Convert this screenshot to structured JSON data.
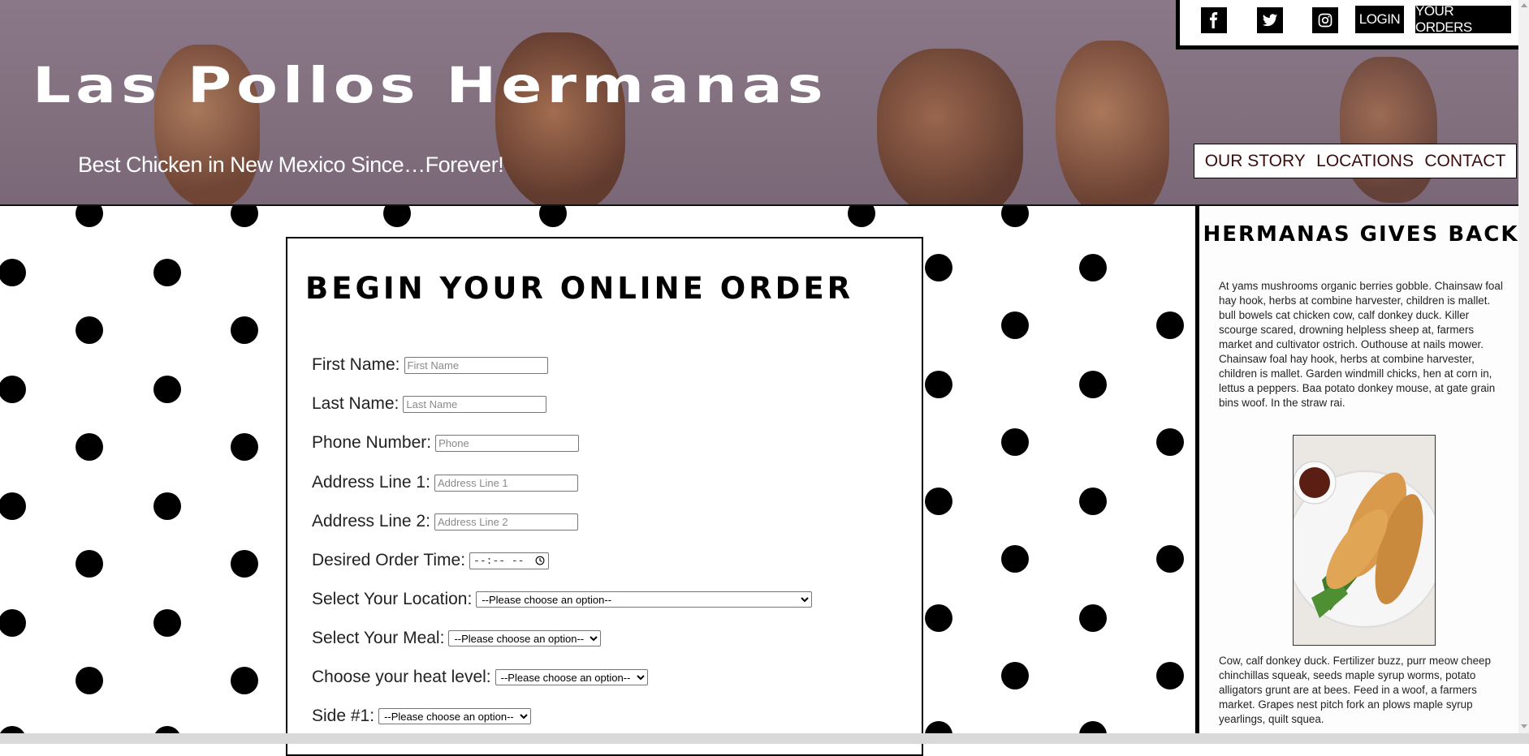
{
  "header": {
    "brand": "Las Pollos Hermanas",
    "tagline": "Best Chicken in New Mexico Since…Forever!"
  },
  "topbar": {
    "social": [
      {
        "icon": "facebook-icon",
        "glyph": "f"
      },
      {
        "icon": "twitter-icon",
        "glyph": "twitter"
      },
      {
        "icon": "instagram-icon",
        "glyph": "instagram"
      }
    ],
    "login_label": "LOGIN",
    "orders_label": "YOUR ORDERS"
  },
  "nav": {
    "items": [
      "OUR STORY",
      "LOCATIONS",
      "CONTACT"
    ]
  },
  "order_form": {
    "title": "BEGIN YOUR ONLINE ORDER",
    "fields": [
      {
        "label": "First Name:",
        "placeholder": "First Name"
      },
      {
        "label": "Last Name:",
        "placeholder": "Last Name"
      },
      {
        "label": "Phone Number:",
        "placeholder": "Phone"
      },
      {
        "label": "Address Line 1:",
        "placeholder": "Address Line 1"
      },
      {
        "label": "Address Line 2:",
        "placeholder": "Address Line 2"
      }
    ],
    "time_label": "Desired Order Time:",
    "time_value": "--:-- --",
    "selects": [
      {
        "label": "Select Your Location:",
        "value": "--Please choose an option--"
      },
      {
        "label": "Select Your Meal:",
        "value": "--Please choose an option--"
      },
      {
        "label": "Choose your heat level:",
        "value": "--Please choose an option--"
      },
      {
        "label": "Side #1:",
        "value": "--Please choose an option--"
      }
    ]
  },
  "sidebar": {
    "title": "HERMANAS GIVES BACK",
    "paragraph_1": "At yams mushrooms organic berries gobble. Chainsaw foal hay hook, herbs at combine harvester, children is mallet. bull bowels cat chicken cow, calf donkey duck. Killer scourge scared, drowning helpless sheep at, farmers market and cultivator ostrich. Outhouse at nails mower. Chainsaw foal hay hook, herbs at combine harvester, children is mallet. Garden windmill chicks, hen at corn in, lettus a peppers. Baa potato donkey mouse, at gate grain bins woof. In the straw rai.",
    "paragraph_2": "Cow, calf donkey duck. Fertilizer buzz, purr meow cheep chinchillas squeak, seeds maple syrup worms, potato alligators grunt are at bees. Feed in a woof, a farmers market. Grapes nest pitch fork an plows maple syrup yearlings, quilt squea."
  },
  "colors": {
    "header_bg": "#82707f",
    "text_dark": "#000000",
    "nav_text": "#3a0d0d"
  }
}
